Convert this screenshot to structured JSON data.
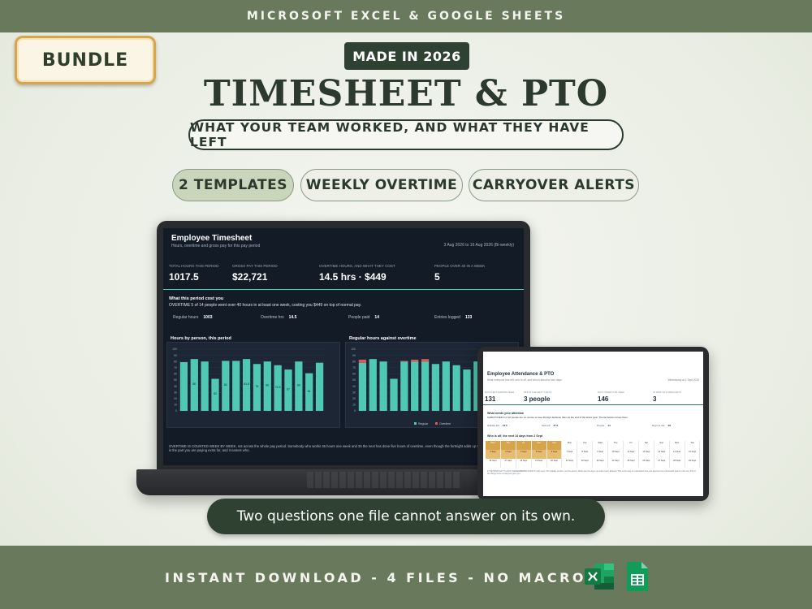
{
  "banner": {
    "top_text": "MICROSOFT EXCEL & GOOGLE SHEETS",
    "bottom_text": "INSTANT DOWNLOAD  -  4 FILES  -  NO MACROS"
  },
  "badge": {
    "bundle": "BUNDLE",
    "made_in": "MADE IN 2026"
  },
  "hero": {
    "title": "TIMESHEET & PTO",
    "tagline": "WHAT YOUR TEAM WORKED, AND WHAT THEY HAVE LEFT",
    "features": [
      "2 TEMPLATES",
      "WEEKLY OVERTIME",
      "CARRYOVER ALERTS"
    ],
    "caption": "Two questions one file cannot answer on its own."
  },
  "icons": {
    "excel": "excel-icon",
    "sheets": "google-sheets-icon"
  },
  "colors": {
    "band": "#687a5b",
    "dark_green": "#2f4130",
    "teal": "#4fc9b4",
    "overtime_red": "#e0584f",
    "gold": "#d8a449"
  },
  "timesheet": {
    "title": "Employee Timesheet",
    "subtitle": "Hours, overtime and gross pay for this pay period",
    "period": "3 Aug 2026 to 16 Aug 2026   (Bi-weekly)",
    "kpis": [
      {
        "label": "TOTAL HOURS THIS PERIOD",
        "value": "1017.5"
      },
      {
        "label": "GROSS PAY THIS PERIOD",
        "value": "$22,721"
      },
      {
        "label": "OVERTIME HOURS, AND WHAT THEY COST",
        "value": "14.5  hrs  ·  $449"
      },
      {
        "label": "PEOPLE OVER 40 IN A WEEK",
        "value": "5"
      }
    ],
    "cost_title": "What this period cost you",
    "cost_line": "OVERTIME  5 of 14 people went over 40 hours in at least one week, costing you $449 on top of normal pay.",
    "stats": [
      {
        "label": "Regular hours",
        "value": "1003"
      },
      {
        "label": "Overtime hrs",
        "value": "14.5"
      },
      {
        "label": "People paid",
        "value": "14"
      },
      {
        "label": "Entries logged",
        "value": "133"
      }
    ],
    "chart1_title": "Hours by person, this period",
    "chart2_title": "Regular hours against overtime",
    "legend": [
      "Regular",
      "Overtime"
    ],
    "footnote": "OVERTIME IS COUNTED WEEK BY WEEK, not across the whole pay period. Somebody who works 45 hours one week and 35 the next has done five hours of overtime, even though the fortnight adds up to 80. The right-hand chart is the part you are paying extra for, and it names who."
  },
  "chart_data": [
    {
      "type": "bar",
      "title": "Hours by person, this period",
      "y_ticks": [
        "100",
        "90",
        "80",
        "70",
        "60",
        "50",
        "40",
        "30",
        "20",
        "10",
        "0"
      ],
      "ylim": [
        0,
        100
      ],
      "categories": [
        "",
        "",
        "",
        "",
        "",
        "",
        "",
        "",
        "",
        "",
        "",
        "",
        "",
        ""
      ],
      "values": [
        79,
        84,
        80,
        52,
        81,
        81,
        84,
        76,
        80,
        74,
        67,
        80,
        61,
        78
      ],
      "value_labels": [
        "",
        "80",
        "",
        "52",
        "81",
        "",
        "81.5",
        "76",
        "80",
        "74.5",
        "67",
        "80",
        "61",
        ""
      ]
    },
    {
      "type": "bar",
      "title": "Regular hours against overtime",
      "y_ticks": [
        "100",
        "90",
        "80",
        "70",
        "60",
        "50",
        "40",
        "30",
        "20",
        "10",
        "0"
      ],
      "ylim": [
        0,
        100
      ],
      "categories": [
        "",
        "",
        "",
        "",
        "",
        "",
        "",
        "",
        "",
        "",
        "",
        "",
        "",
        ""
      ],
      "series": [
        {
          "name": "Regular",
          "values": [
            78,
            84,
            80,
            52,
            80,
            80,
            80,
            76,
            80,
            74,
            67,
            80,
            61,
            78
          ]
        },
        {
          "name": "Overtime",
          "values": [
            5,
            0,
            0,
            0,
            1,
            3,
            4,
            0,
            0,
            0,
            0,
            0,
            0,
            2
          ]
        }
      ]
    }
  ],
  "pto": {
    "title": "Employee Attendance & PTO",
    "subtitle": "What everyone has left, who is off, and who is about to lose days",
    "date": "Wednesday at 2 Sept 2026",
    "kpis": [
      {
        "label": "DAYS LEFT ACROSS TEAM",
        "value": "131"
      },
      {
        "label": "OFF IN THE NEXT 2 DAYS",
        "value": "3 people"
      },
      {
        "label": "DAYS TAKEN THIS YEAR",
        "value": "146"
      },
      {
        "label": "AT RISK OF LOSING DAYS",
        "value": "3"
      }
    ],
    "attention_title": "What needs your attention",
    "carryover_line": "CARRYOVER  3 of 16 people are on course to lose 36 days between them at the end of the leave year. The list below names them.",
    "stats": [
      {
        "label": "Holiday left",
        "value": "73.5"
      },
      {
        "label": "Sick left",
        "value": "37.5"
      },
      {
        "label": "People",
        "value": "14"
      },
      {
        "label": "Days at risk",
        "value": "29"
      }
    ],
    "who_title": "Who is off, the next 14 days from 2 Sept",
    "calendar_row1": [
      "Wed",
      "Thu",
      "Fri",
      "Sat",
      "Sun",
      "Mon",
      "Tue",
      "Wed",
      "Thu",
      "Fri",
      "Sat",
      "Sun",
      "Mon",
      "Tue"
    ],
    "calendar_row2": [
      "2 Sept",
      "3 Sept",
      "4 Sept",
      "5 Sept",
      "6 Sept",
      "7 Sept",
      "8 Sept",
      "9 Sept",
      "10 Sept",
      "11 Sept",
      "12 Sept",
      "13 Sept",
      "14 Sept",
      "15 Sept"
    ],
    "calendar_row3": [
      "16 Sept",
      "17 Sept",
      "18 Sept",
      "19 Sept",
      "20 Sept",
      "21 Sept",
      "22 Sept",
      "23 Sept",
      "24 Sept",
      "25 Sept",
      "26 Sept",
      "27 Sept",
      "28 Sept",
      "29 Sept"
    ],
    "footnote": "A TRUSTED DAY IS A DAY REMEMBERED ALWAYS until used. The holiday section, not the parent. Roots are the days you have been allowed. This is the way to understand how you approve the roll forward. Each is the very first of the things some employees give you."
  }
}
